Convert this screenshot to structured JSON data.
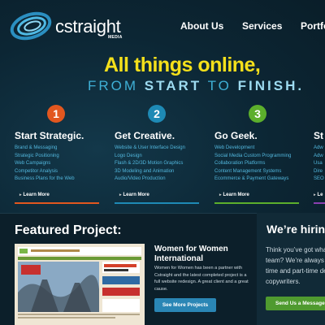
{
  "brand": {
    "name": "cstraight",
    "sub": "MEDIA"
  },
  "nav": [
    {
      "label": "About Us"
    },
    {
      "label": "Services"
    },
    {
      "label": "Portfo"
    }
  ],
  "hero": {
    "line1": "All things online,",
    "line2_a": "FROM ",
    "line2_b": "START",
    "line2_c": " TO ",
    "line2_d": "FINISH.",
    "line2_e": ""
  },
  "columns": [
    {
      "number": "1",
      "color": "#e2571f",
      "title": "Start Strategic.",
      "items": [
        "Brand & Messaging",
        "Strategic Positioning",
        "Web Campaigns",
        "Competitor Analysis",
        "Business Plans for the Web"
      ],
      "more": "Learn More"
    },
    {
      "number": "2",
      "color": "#1e8ab5",
      "title": "Get Creative.",
      "items": [
        "Website & User Interface Design",
        "Logo Design",
        "Flash & 2D/3D Motion Graphics",
        "3D Modeling and Animation",
        "Audio/Video Production"
      ],
      "more": "Learn More"
    },
    {
      "number": "3",
      "color": "#5caf2c",
      "title": "Go Geek.",
      "items": [
        "Web Development",
        "Social Media Custom Programming",
        "Collaboration Platforms",
        "Content Management Systems",
        "Ecommerce & Payment Gateways"
      ],
      "more": "Learn More"
    },
    {
      "number": "",
      "color": "#8a3fb0",
      "title": "St",
      "items": [
        "Adw",
        "Adw",
        "Usa",
        "Dire",
        "SEO"
      ],
      "more": "Le"
    }
  ],
  "featured": {
    "heading": "Featured Project:",
    "project_name": "Women for Women International",
    "description": "Women for Women has been a partner with Cstraight and the latest completed project is a full website redesign. A great client and a great cause.",
    "button": "See More Projects"
  },
  "hiring": {
    "heading": "We’re hiring",
    "lines": [
      "Think you’ve got wha",
      "team? We’re always",
      "time and part-time de",
      "copywriters."
    ],
    "button": "Send Us a Message"
  },
  "colors": {
    "accent_yellow": "#f4e01b",
    "accent_blue": "#3fb0d6",
    "link_blue": "#52b7dd"
  }
}
